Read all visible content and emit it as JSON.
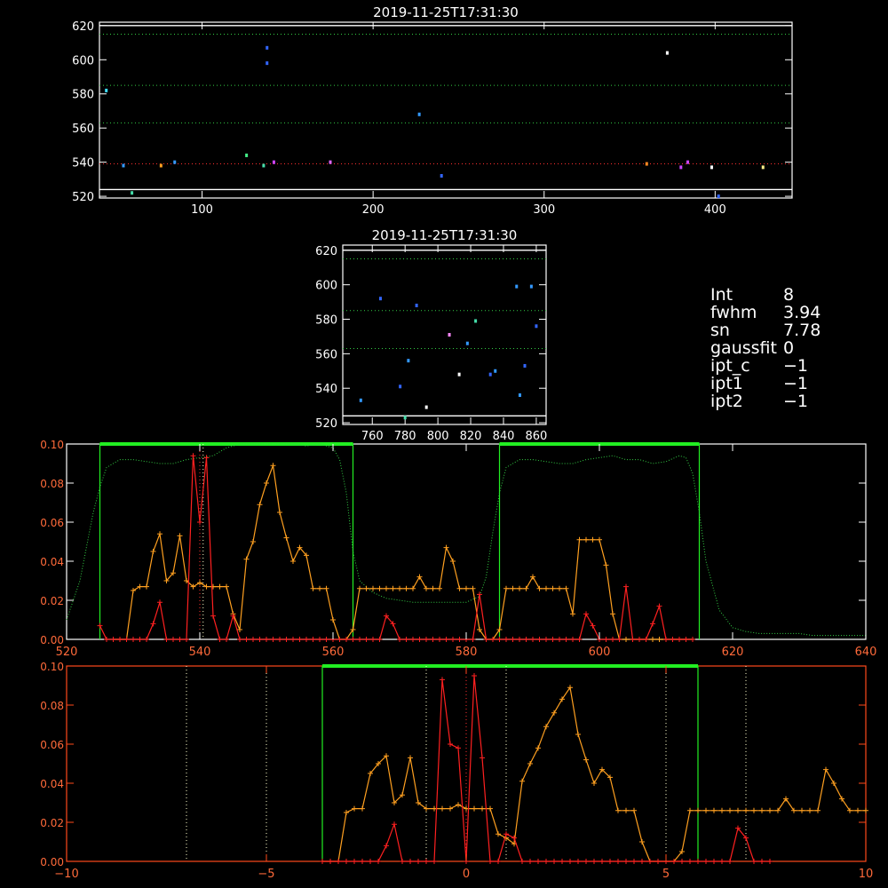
{
  "colors": {
    "background": "#000000",
    "axis": "#ffffff",
    "axis_lower": "#ff4a1a",
    "tick_red": "#ff6a3a",
    "green_line": "#22ee22",
    "green_dot": "#33cc44",
    "orange_series": "#ffa020",
    "red_series": "#ff2020",
    "red_dotted": "#ff3030",
    "white_dotted": "#ffffcc",
    "spectrum_dot": "#22ccff"
  },
  "info_panel": [
    {
      "key": "Int",
      "value": "8"
    },
    {
      "key": "fwhm",
      "value": "3.94"
    },
    {
      "key": "sn",
      "value": "7.78"
    },
    {
      "key": "gaussfit",
      "value": "0"
    },
    {
      "key": "ipt_c",
      "value": "−1"
    },
    {
      "key": "ipt1",
      "value": "−1"
    },
    {
      "key": "ipt2",
      "value": "−1"
    }
  ],
  "chart_data": [
    {
      "type": "scatter",
      "title": "2019-11-25T17:31:30",
      "xlim": [
        40,
        445
      ],
      "ylim": [
        519,
        622
      ],
      "xticks": [
        100,
        200,
        300,
        400
      ],
      "yticks": [
        520,
        540,
        560,
        580,
        600,
        620
      ],
      "hlines_white": [
        524,
        620
      ],
      "hlines_green": [
        563,
        585,
        615
      ],
      "hlines_red": [
        539
      ],
      "points": [
        {
          "x": 44,
          "y": 582,
          "c": "#40e0ff"
        },
        {
          "x": 54,
          "y": 538,
          "c": "#3399ff"
        },
        {
          "x": 59,
          "y": 522,
          "c": "#44ddaa"
        },
        {
          "x": 76,
          "y": 538,
          "c": "#ffa020"
        },
        {
          "x": 84,
          "y": 540,
          "c": "#3399ff"
        },
        {
          "x": 126,
          "y": 544,
          "c": "#44ee88"
        },
        {
          "x": 136,
          "y": 538,
          "c": "#44ddaa"
        },
        {
          "x": 138,
          "y": 598,
          "c": "#3366ff"
        },
        {
          "x": 138,
          "y": 607,
          "c": "#3366ff"
        },
        {
          "x": 142,
          "y": 540,
          "c": "#cc44ff"
        },
        {
          "x": 175,
          "y": 540,
          "c": "#dd66ff"
        },
        {
          "x": 227,
          "y": 568,
          "c": "#3399ff"
        },
        {
          "x": 240,
          "y": 532,
          "c": "#3366ff"
        },
        {
          "x": 360,
          "y": 539,
          "c": "#ff8822"
        },
        {
          "x": 372,
          "y": 604,
          "c": "#ffffff"
        },
        {
          "x": 380,
          "y": 537,
          "c": "#cc44ff"
        },
        {
          "x": 384,
          "y": 540,
          "c": "#cc44ff"
        },
        {
          "x": 398,
          "y": 537,
          "c": "#ffffff"
        },
        {
          "x": 402,
          "y": 520,
          "c": "#3366ff"
        },
        {
          "x": 428,
          "y": 537,
          "c": "#ffee88"
        }
      ]
    },
    {
      "type": "scatter",
      "title": "2019-11-25T17:31:30",
      "xlim": [
        742,
        866
      ],
      "ylim": [
        519,
        623
      ],
      "xticks": [
        760,
        780,
        800,
        820,
        840,
        860
      ],
      "yticks": [
        520,
        540,
        560,
        580,
        600,
        620
      ],
      "hlines_white": [
        524,
        620
      ],
      "hlines_green": [
        563,
        585,
        615
      ],
      "points": [
        {
          "x": 753,
          "y": 533,
          "c": "#3399ff"
        },
        {
          "x": 765,
          "y": 592,
          "c": "#3366ff"
        },
        {
          "x": 777,
          "y": 541,
          "c": "#3366ff"
        },
        {
          "x": 780,
          "y": 523,
          "c": "#44ddaa"
        },
        {
          "x": 782,
          "y": 556,
          "c": "#3399ff"
        },
        {
          "x": 787,
          "y": 588,
          "c": "#3366ff"
        },
        {
          "x": 793,
          "y": 529,
          "c": "#ffffff"
        },
        {
          "x": 807,
          "y": 571,
          "c": "#ff88ff"
        },
        {
          "x": 813,
          "y": 548,
          "c": "#ffffff"
        },
        {
          "x": 818,
          "y": 566,
          "c": "#3399ff"
        },
        {
          "x": 823,
          "y": 579,
          "c": "#44ddaa"
        },
        {
          "x": 832,
          "y": 548,
          "c": "#3366ff"
        },
        {
          "x": 835,
          "y": 550,
          "c": "#3399ff"
        },
        {
          "x": 848,
          "y": 599,
          "c": "#3399ff"
        },
        {
          "x": 850,
          "y": 536,
          "c": "#3399ff"
        },
        {
          "x": 853,
          "y": 553,
          "c": "#3366ff"
        },
        {
          "x": 857,
          "y": 599,
          "c": "#3399ff"
        },
        {
          "x": 860,
          "y": 576,
          "c": "#3366ff"
        }
      ]
    },
    {
      "type": "line",
      "xlim": [
        520,
        640
      ],
      "ylim": [
        0,
        0.1
      ],
      "xticks": [
        520,
        540,
        560,
        580,
        600,
        620,
        640
      ],
      "yticks": [
        "0.00",
        "0.02",
        "0.04",
        "0.06",
        "0.08",
        "0.10"
      ],
      "green_boxes": [
        [
          525,
          563,
          0.1
        ],
        [
          585,
          615,
          0.1
        ]
      ],
      "red_vline": 540,
      "white_vline": 540.5,
      "series": [
        {
          "color": "#ffa020",
          "x": [
            527,
            528,
            529,
            530,
            531,
            532,
            533,
            534,
            535,
            536,
            537,
            538,
            539,
            540,
            541,
            542,
            543,
            544,
            545,
            546,
            547,
            548,
            549,
            550,
            551,
            552,
            553,
            554,
            555,
            556,
            557,
            558,
            559,
            560,
            561,
            562,
            563,
            564,
            565,
            566,
            567,
            568,
            569,
            570,
            571,
            572,
            573,
            574,
            575,
            576,
            577,
            578,
            579,
            580,
            581,
            582,
            583,
            584,
            585,
            586,
            587,
            588,
            589,
            590,
            591,
            592,
            593,
            594,
            595,
            596,
            597,
            598,
            599,
            600,
            601,
            602,
            603,
            604,
            605,
            606,
            607,
            608,
            609,
            610,
            611,
            612,
            613,
            614
          ],
          "y": [
            0,
            0,
            0,
            0.025,
            0.027,
            0.027,
            0.045,
            0.054,
            0.03,
            0.034,
            0.053,
            0.03,
            0.027,
            0.029,
            0.027,
            0.027,
            0.027,
            0.027,
            0.013,
            0.005,
            0.041,
            0.05,
            0.069,
            0.08,
            0.089,
            0.065,
            0.052,
            0.04,
            0.047,
            0.043,
            0.026,
            0.026,
            0.026,
            0.01,
            0,
            0,
            0.005,
            0.026,
            0.026,
            0.026,
            0.026,
            0.026,
            0.026,
            0.026,
            0.026,
            0.026,
            0.032,
            0.026,
            0.026,
            0.026,
            0.047,
            0.04,
            0.026,
            0.026,
            0.026,
            0.005,
            0,
            0,
            0.005,
            0.026,
            0.026,
            0.026,
            0.026,
            0.032,
            0.026,
            0.026,
            0.026,
            0.026,
            0.026,
            0.013,
            0.051,
            0.051,
            0.051,
            0.051,
            0.038,
            0.013,
            0,
            0,
            0,
            0,
            0,
            0,
            0,
            0,
            0,
            0,
            0,
            0
          ]
        },
        {
          "color": "#ff2020",
          "x": [
            525,
            526,
            527,
            528,
            529,
            530,
            531,
            532,
            533,
            534,
            535,
            536,
            537,
            538,
            539,
            540,
            541,
            542,
            543,
            544,
            545,
            546,
            547,
            548,
            549,
            550,
            551,
            552,
            553,
            554,
            555,
            556,
            557,
            558,
            559,
            560,
            561,
            562,
            563,
            564,
            565,
            566,
            567,
            568,
            569,
            570,
            571,
            572,
            573,
            574,
            575,
            576,
            577,
            578,
            579,
            580,
            581,
            582,
            583,
            584,
            585,
            586,
            587,
            588,
            589,
            590,
            591,
            592,
            593,
            594,
            595,
            596,
            597,
            598,
            599,
            600,
            601,
            602,
            603,
            604,
            605,
            606,
            607,
            608,
            609,
            610,
            611,
            612,
            613,
            614
          ],
          "y": [
            0.007,
            0,
            0,
            0,
            0,
            0,
            0,
            0,
            0.008,
            0.019,
            0,
            0,
            0,
            0,
            0.094,
            0.06,
            0.093,
            0.012,
            0,
            0,
            0.012,
            0,
            0,
            0,
            0,
            0,
            0,
            0,
            0,
            0,
            0,
            0,
            0,
            0,
            0,
            0,
            0,
            0,
            0,
            0,
            0,
            0,
            0,
            0.012,
            0.008,
            0,
            0,
            0,
            0,
            0,
            0,
            0,
            0,
            0,
            0,
            0,
            0,
            0.023,
            0,
            0,
            0,
            0,
            0,
            0,
            0,
            0,
            0,
            0,
            0,
            0,
            0,
            0,
            0,
            0.013,
            0.007,
            0,
            0,
            0,
            0,
            0.027,
            0,
            0,
            0,
            0.008,
            0.017,
            0,
            0,
            0,
            0,
            0
          ]
        }
      ],
      "dotted_curve": {
        "color": "#33cc44",
        "x": [
          520,
          522,
          524,
          525,
          526,
          528,
          530,
          532,
          534,
          536,
          538,
          540,
          542,
          544,
          546,
          548,
          550,
          552,
          554,
          556,
          558,
          560,
          561,
          562,
          563,
          564,
          566,
          568,
          570,
          572,
          574,
          576,
          578,
          580,
          582,
          583,
          584,
          585,
          586,
          588,
          590,
          592,
          594,
          596,
          598,
          600,
          602,
          604,
          606,
          608,
          610,
          612,
          613,
          614,
          615,
          616,
          618,
          620,
          622,
          624,
          626,
          628,
          630,
          632,
          634,
          636,
          638,
          640
        ],
        "y": [
          0.01,
          0.03,
          0.065,
          0.078,
          0.088,
          0.092,
          0.092,
          0.091,
          0.09,
          0.09,
          0.092,
          0.093,
          0.094,
          0.098,
          0.1,
          0.1,
          0.1,
          0.1,
          0.1,
          0.099,
          0.1,
          0.098,
          0.092,
          0.075,
          0.045,
          0.03,
          0.024,
          0.021,
          0.02,
          0.019,
          0.019,
          0.019,
          0.019,
          0.019,
          0.022,
          0.032,
          0.055,
          0.075,
          0.088,
          0.092,
          0.092,
          0.091,
          0.09,
          0.09,
          0.092,
          0.093,
          0.094,
          0.092,
          0.092,
          0.09,
          0.091,
          0.094,
          0.093,
          0.085,
          0.065,
          0.04,
          0.015,
          0.006,
          0.004,
          0.003,
          0.003,
          0.003,
          0.003,
          0.002,
          0.002,
          0.002,
          0.002,
          0.002
        ]
      }
    },
    {
      "type": "line",
      "xlim": [
        -10,
        10
      ],
      "ylim": [
        0,
        0.1
      ],
      "xticks": [
        -10,
        -5,
        0,
        5,
        10
      ],
      "yticks": [
        "0.00",
        "0.02",
        "0.04",
        "0.06",
        "0.08",
        "0.10"
      ],
      "green_box": [
        -3.6,
        5.8,
        0.1
      ],
      "white_vlines": [
        -7,
        -5,
        -1,
        1,
        5,
        7
      ],
      "red_vline": 0,
      "series": [
        {
          "color": "#ffa020",
          "x": [
            -3.6,
            -3.4,
            -3.2,
            -3.0,
            -2.8,
            -2.6,
            -2.4,
            -2.2,
            -2.0,
            -1.8,
            -1.6,
            -1.4,
            -1.2,
            -1.0,
            -0.8,
            -0.6,
            -0.4,
            -0.2,
            0.0,
            0.2,
            0.4,
            0.6,
            0.8,
            1.0,
            1.2,
            1.4,
            1.6,
            1.8,
            2.0,
            2.2,
            2.4,
            2.6,
            2.8,
            3.0,
            3.2,
            3.4,
            3.6,
            3.8,
            4.0,
            4.2,
            4.4,
            4.6,
            4.8,
            5.0,
            5.2,
            5.4,
            5.6,
            5.8,
            6.0,
            6.2,
            6.4,
            6.6,
            6.8,
            7.0,
            7.2,
            7.4,
            7.6,
            7.8,
            8.0,
            8.2,
            8.4,
            8.6,
            8.8,
            9.0,
            9.2,
            9.4,
            9.6,
            9.8,
            10.0
          ],
          "y": [
            0,
            0,
            0,
            0.025,
            0.027,
            0.027,
            0.045,
            0.05,
            0.054,
            0.03,
            0.034,
            0.053,
            0.03,
            0.027,
            0.027,
            0.027,
            0.027,
            0.029,
            0.027,
            0.027,
            0.027,
            0.027,
            0.014,
            0.012,
            0.009,
            0.041,
            0.05,
            0.058,
            0.069,
            0.076,
            0.083,
            0.089,
            0.065,
            0.052,
            0.04,
            0.047,
            0.043,
            0.026,
            0.026,
            0.026,
            0.01,
            0,
            0,
            0,
            0,
            0.005,
            0.026,
            0.026,
            0.026,
            0.026,
            0.026,
            0.026,
            0.026,
            0.026,
            0.026,
            0.026,
            0.026,
            0.026,
            0.032,
            0.026,
            0.026,
            0.026,
            0.026,
            0.047,
            0.04,
            0.032,
            0.026,
            0.026,
            0.026
          ]
        },
        {
          "color": "#ff2020",
          "x": [
            -3.6,
            -3.4,
            -3.2,
            -3.0,
            -2.8,
            -2.6,
            -2.4,
            -2.2,
            -2.0,
            -1.8,
            -1.6,
            -1.4,
            -1.2,
            -1.0,
            -0.8,
            -0.6,
            -0.4,
            -0.2,
            0.0,
            0.2,
            0.4,
            0.6,
            0.8,
            1.0,
            1.2,
            1.4,
            1.6,
            1.8,
            2.0,
            2.2,
            2.4,
            2.6,
            2.8,
            3.0,
            3.2,
            3.4,
            3.6,
            3.8,
            4.0,
            4.2,
            4.4,
            4.6,
            4.8,
            5.0,
            5.2,
            5.4,
            5.6,
            5.8,
            6.0,
            6.2,
            6.4,
            6.6,
            6.8,
            7.0,
            7.2,
            7.4,
            7.6
          ],
          "y": [
            0,
            0,
            0,
            0,
            0,
            0,
            0,
            0,
            0.008,
            0.019,
            0,
            0,
            0,
            0,
            0,
            0.093,
            0.06,
            0.058,
            0,
            0.095,
            0.053,
            0,
            0,
            0.014,
            0.012,
            0,
            0,
            0,
            0,
            0,
            0,
            0,
            0,
            0,
            0,
            0,
            0,
            0,
            0,
            0,
            0,
            0,
            0,
            0,
            0,
            0,
            0,
            0,
            0,
            0,
            0,
            0,
            0.017,
            0.012,
            0,
            0,
            0
          ]
        }
      ]
    }
  ]
}
